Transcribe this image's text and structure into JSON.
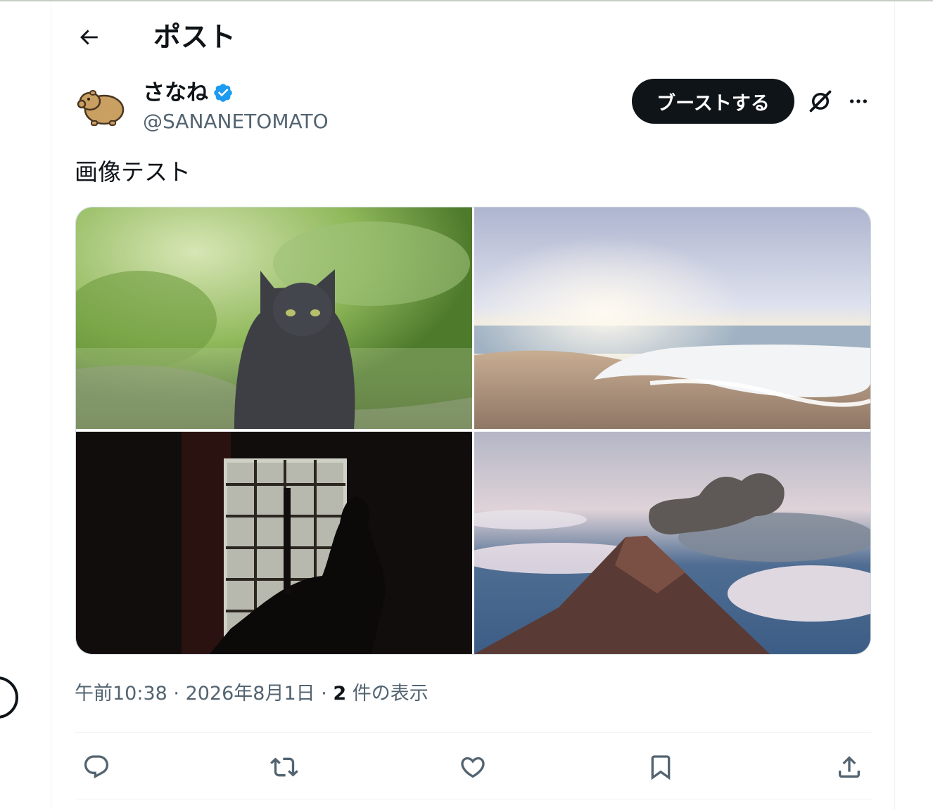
{
  "header": {
    "title": "ポスト",
    "back_icon": "arrow-left-icon"
  },
  "author": {
    "display_name": "さなね",
    "handle": "@SANANETOMATO",
    "verified": true,
    "verified_color": "#1d9bf0",
    "avatar_icon": "capybara-icon"
  },
  "actions_top": {
    "boost_label": "ブーストする",
    "grok_icon": "grok-icon",
    "more_icon": "more-icon"
  },
  "post": {
    "text": "画像テスト",
    "media": [
      {
        "subject": "gray cat on green background"
      },
      {
        "subject": "sunset beach waves"
      },
      {
        "subject": "silhouette person by window"
      },
      {
        "subject": "erupting volcano above clouds"
      }
    ]
  },
  "meta": {
    "time": "午前10:38",
    "separator1": " · ",
    "date": "2026年8月1日",
    "separator2": " · ",
    "views_count": "2",
    "views_label": " 件の表示"
  },
  "action_bar": [
    {
      "name": "reply",
      "icon": "reply-icon"
    },
    {
      "name": "repost",
      "icon": "repost-icon"
    },
    {
      "name": "like",
      "icon": "heart-icon"
    },
    {
      "name": "bookmark",
      "icon": "bookmark-icon"
    },
    {
      "name": "share",
      "icon": "share-icon"
    }
  ],
  "colors": {
    "text_primary": "#0f1419",
    "text_secondary": "#536471",
    "border": "#eff3f4",
    "button_dark": "#0f1419"
  }
}
